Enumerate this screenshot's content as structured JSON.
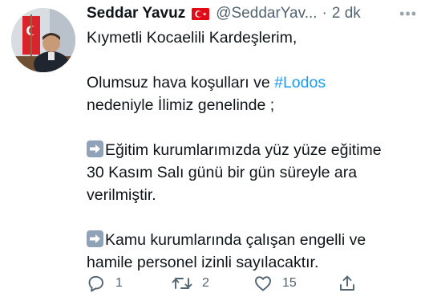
{
  "tweet": {
    "author_name": "Seddar Yavuz",
    "handle": "@SeddarYav...",
    "separator": "·",
    "time": "2 dk",
    "more": "•••",
    "lines": {
      "l1": "Kıymetli Kocaelili Kardeşlerim,",
      "l2_text": "Olumsuz hava koşulları ve ",
      "l2_hashtag": "#Lodos",
      "l3": "nedeniyle İlimiz genelinde ;",
      "l4": "Eğitim kurumlarımızda yüz yüze eğitime",
      "l5": "30 Kasım Salı günü bir gün süreyle ara",
      "l6": "verilmiştir.",
      "l7": "Kamu kurumlarında çalışan engelli ve",
      "l8": "hamile personel izinli sayılacaktır."
    }
  },
  "actions": {
    "reply_count": "1",
    "retweet_count": "2",
    "like_count": "15"
  },
  "colors": {
    "text": "#0f1419",
    "secondary": "#536471",
    "hashtag": "#1d9bf0",
    "flag_red": "#e30a17"
  },
  "icons": [
    "avatar",
    "turkey-flag-icon",
    "more-icon",
    "right-arrow-emoji-icon",
    "reply-icon",
    "retweet-icon",
    "like-icon",
    "share-icon"
  ]
}
